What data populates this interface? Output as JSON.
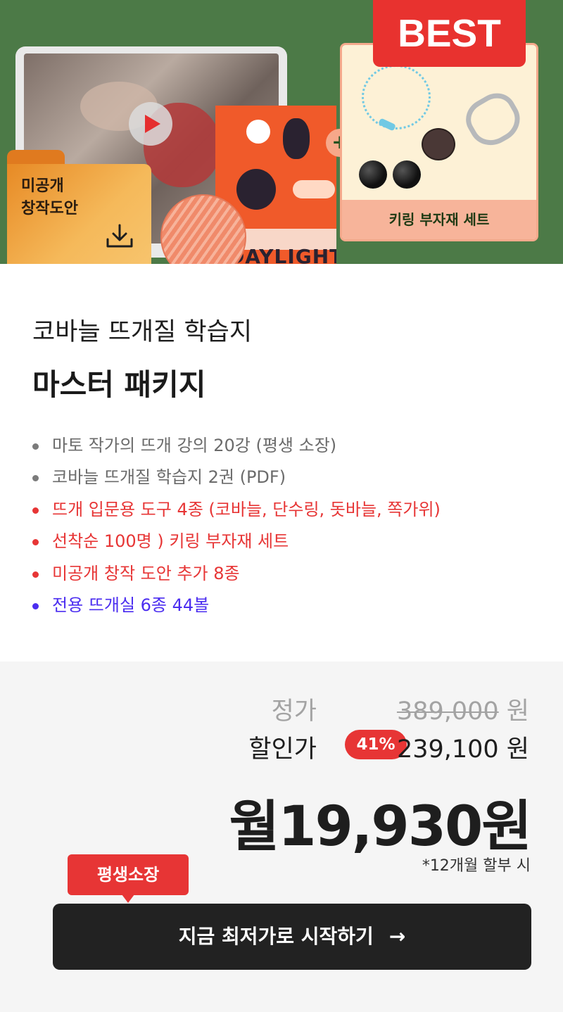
{
  "hero": {
    "best_label": "BEST",
    "folder_label": "미공개\n창작도안",
    "book_title": "DAYLIGHT",
    "plus_label": "+",
    "kit_label": "키링 부자재 세트"
  },
  "product": {
    "subtitle": "코바늘 뜨개질 학습지",
    "title": "마스터 패키지",
    "features": [
      {
        "text": "마토 작가의 뜨개 강의 20강 (평생 소장)",
        "color": "#6b6b6b"
      },
      {
        "text": "코바늘 뜨개질 학습지 2권 (PDF)",
        "color": "#6b6b6b"
      },
      {
        "text": "뜨개 입문용 도구 4종 (코바늘, 단수링, 돗바늘, 쪽가위)",
        "color": "#e73535"
      },
      {
        "text": "선착순 100명 ) 키링 부자재 세트",
        "color": "#e73535"
      },
      {
        "text": "미공개 창작 도안 추가 8종",
        "color": "#e73535"
      },
      {
        "text": "전용 뜨개실 6종 44볼",
        "color": "#4b2df0"
      }
    ]
  },
  "price": {
    "regular_label": "정가",
    "regular_value": "389,000",
    "regular_unit": " 원",
    "sale_label": "할인가",
    "discount_badge": "41%",
    "sale_value": "239,100 원",
    "monthly": "월19,930원",
    "installment_note": "*12개월 할부 시"
  },
  "cta": {
    "tooltip": "평생소장",
    "button_label": "지금 최저가로 시작하기",
    "arrow": "→"
  },
  "colors": {
    "hero_bg": "#4c7a47",
    "accent_red": "#e73535",
    "accent_blue": "#4b2df0",
    "cta_bg": "#222222",
    "price_bg": "#f5f5f5"
  }
}
